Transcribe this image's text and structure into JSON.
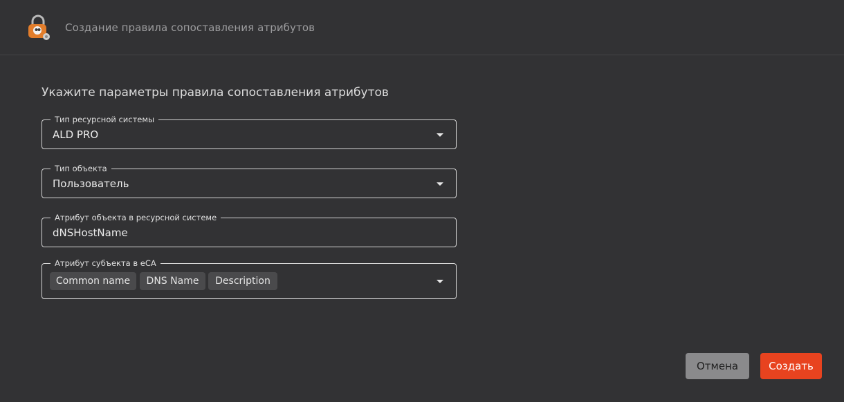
{
  "header": {
    "title": "Создание правила сопоставления атрибутов"
  },
  "form": {
    "heading": "Укажите параметры правила сопоставления атрибутов",
    "resource_system_type": {
      "label": "Тип ресурсной системы",
      "value": "ALD PRO"
    },
    "object_type": {
      "label": "Тип объекта",
      "value": "Пользователь"
    },
    "object_attribute": {
      "label": "Атрибут объекта в ресурсной системе",
      "value": "dNSHostName"
    },
    "subject_attribute": {
      "label": "Атрибут субъекта в eCA",
      "chips": [
        "Common name",
        "DNS Name",
        "Description"
      ]
    }
  },
  "actions": {
    "cancel_label": "Отмена",
    "create_label": "Создать"
  },
  "colors": {
    "background": "#323234",
    "accent": "#e8431f",
    "cancel_button": "#8a8a8c"
  }
}
